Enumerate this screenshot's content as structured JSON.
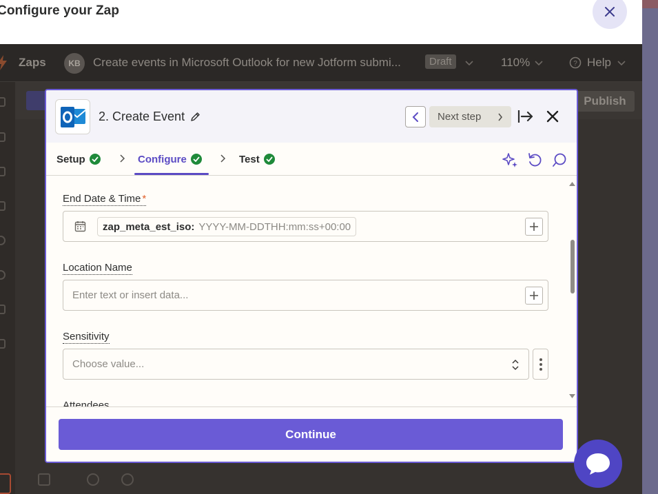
{
  "dialog": {
    "title": "Configure your Zap"
  },
  "background": {
    "app_name": "Zaps",
    "avatar_initials": "KB",
    "zap_title": "Create events in Microsoft Outlook for new Jotform submi...",
    "status_badge": "Draft",
    "zoom": "110%",
    "help_label": "Help",
    "publish_label": "Publish"
  },
  "panel": {
    "step_title": "2. Create Event",
    "app_icon": "microsoft-outlook-icon",
    "next_step_label": "Next step",
    "tabs": [
      {
        "label": "Setup",
        "done": true
      },
      {
        "label": "Configure",
        "done": true,
        "active": true
      },
      {
        "label": "Test",
        "done": true
      }
    ],
    "fields": {
      "end_datetime": {
        "label": "End Date & Time",
        "required_mark": "*",
        "pill_key": "zap_meta_est_iso:",
        "pill_value": "YYYY-MM-DDTHH:mm:ss+00:00"
      },
      "location_name": {
        "label": "Location Name",
        "placeholder": "Enter text or insert data..."
      },
      "sensitivity": {
        "label": "Sensitivity",
        "placeholder": "Choose value..."
      },
      "attendees": {
        "label": "Attendees"
      }
    },
    "continue_label": "Continue"
  },
  "colors": {
    "accent": "#6a5bd6",
    "success": "#1f8a3a",
    "required": "#e0602a"
  }
}
